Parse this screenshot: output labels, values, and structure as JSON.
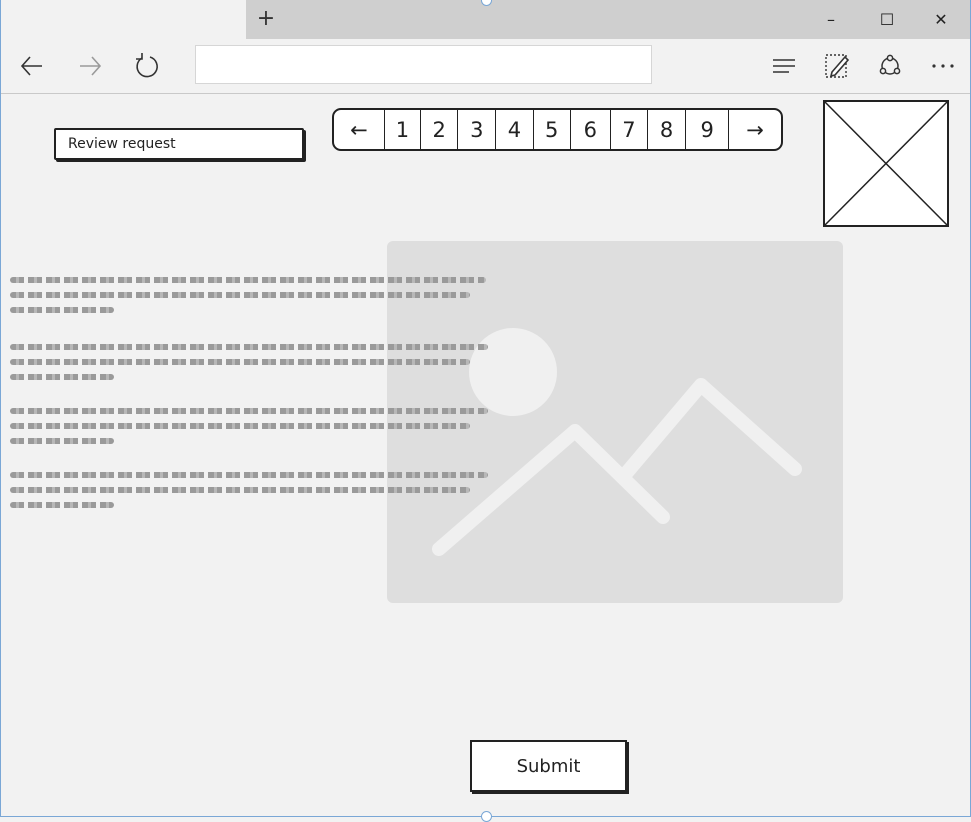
{
  "browser": {
    "new_tab_symbol": "+",
    "window_buttons": {
      "minimize": "–",
      "maximize": "☐",
      "close": "✕"
    },
    "address_value": ""
  },
  "content": {
    "review_label": "Review request",
    "pager": {
      "prev": "←",
      "pages": [
        "1",
        "2",
        "3",
        "4",
        "5",
        "6",
        "7",
        "8",
        "9"
      ],
      "next": "→"
    },
    "submit_label": "Submit"
  }
}
